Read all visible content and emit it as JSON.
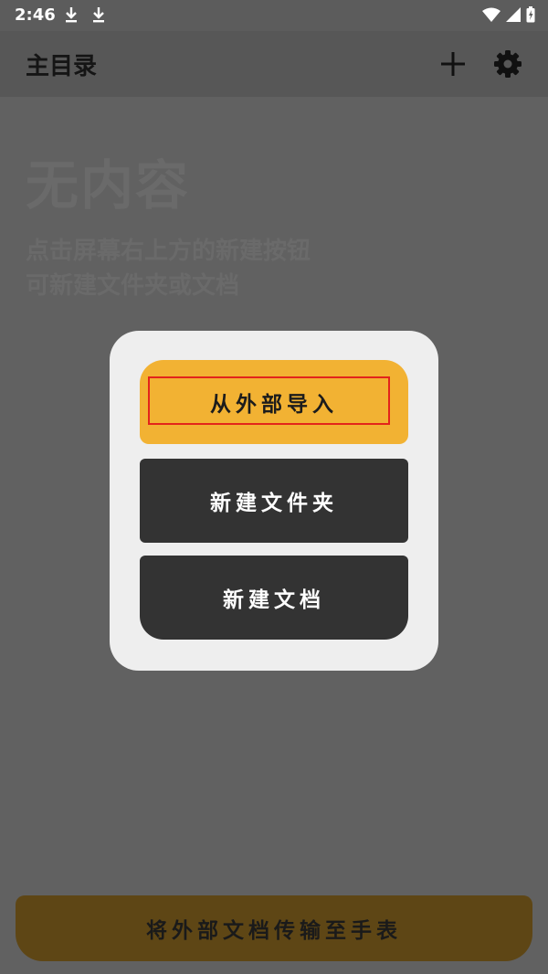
{
  "status_bar": {
    "time": "2:46"
  },
  "app_bar": {
    "title": "主目录"
  },
  "empty_state": {
    "title": "无内容",
    "line1": "点击屏幕右上方的新建按钮",
    "line2": "可新建文件夹或文档"
  },
  "dialog": {
    "import_label": "从外部导入",
    "new_folder_label": "新建文件夹",
    "new_doc_label": "新建文档"
  },
  "bottom_bar": {
    "transfer_label": "将外部文档传输至手表"
  },
  "colors": {
    "background": "#616161",
    "accent": "#f2b233",
    "highlight": "#e3241b",
    "button_dark": "#333333",
    "bottom_button": "#5e4615"
  }
}
